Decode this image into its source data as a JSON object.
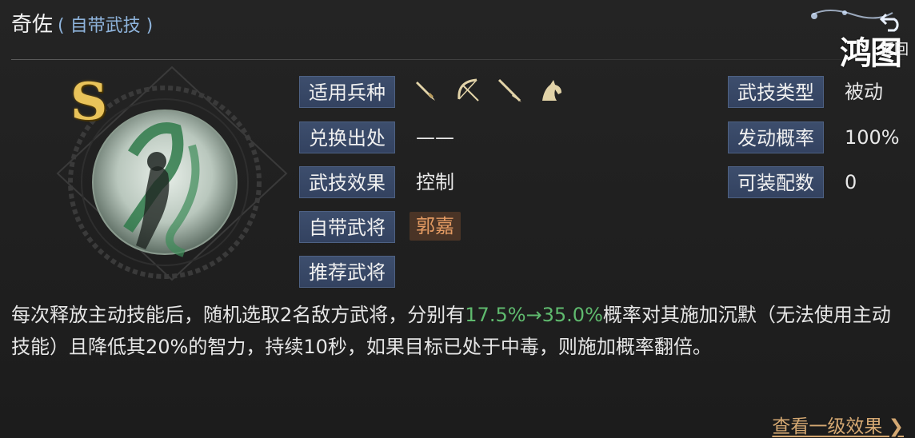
{
  "title": {
    "main": "奇佐",
    "sub": "( 自带武技 )"
  },
  "logo_text": "鸿图",
  "return_label": "返回",
  "grade": "S",
  "left_fields": [
    {
      "label": "适用兵种",
      "value": ""
    },
    {
      "label": "兑换出处",
      "value": "——"
    },
    {
      "label": "武技效果",
      "value": "控制"
    },
    {
      "label": "自带武将",
      "value": "郭嘉"
    },
    {
      "label": "推荐武将",
      "value": ""
    }
  ],
  "troop_icons": [
    "saber-icon",
    "bow-icon",
    "spear-icon",
    "horse-icon"
  ],
  "right_fields": [
    {
      "label": "武技类型",
      "value": "被动"
    },
    {
      "label": "发动概率",
      "value": "100%"
    },
    {
      "label": "可装配数",
      "value": "0"
    }
  ],
  "description": {
    "part1": "每次释放主动技能后，随机选取2名敌方武将，分别有",
    "highlight": "17.5%→35.0%",
    "part2": "概率对其施加沉默（无法使用主动技能）且降低其20%的智力，持续10秒，如果目标已处于中毒，则施加概率翻倍。"
  },
  "detail_link": "查看一级效果 ❯",
  "colors": {
    "label_bg": "#3a4b6a",
    "highlight": "#5fba6e",
    "general_tag": "#e39a62",
    "link": "#d4a872",
    "grade": "#e9c35a"
  }
}
